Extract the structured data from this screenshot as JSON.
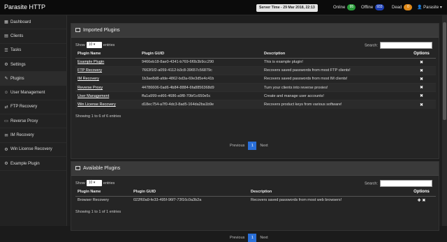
{
  "header": {
    "brand": "Parasite HTTP",
    "server_time": "Server Time - 29 Mar 2018, 22:13",
    "online_label": "Online",
    "online_count": "95",
    "offline_label": "Offline",
    "offline_count": "933",
    "dead_label": "Dead",
    "dead_count": "0",
    "user": "Parasite"
  },
  "sidebar": {
    "items": [
      {
        "label": "Dashboard",
        "icon": "dashboard-icon"
      },
      {
        "label": "Clients",
        "icon": "clients-icon"
      },
      {
        "label": "Tasks",
        "icon": "tasks-icon"
      },
      {
        "label": "Settings",
        "icon": "gear-icon"
      },
      {
        "label": "Plugins",
        "icon": "plug-icon"
      },
      {
        "label": "User Management",
        "icon": "user-icon"
      },
      {
        "label": "FTP Recovery",
        "icon": "ftp-icon"
      },
      {
        "label": "Reverse Proxy",
        "icon": "monitor-icon"
      },
      {
        "label": "IM Recovery",
        "icon": "chat-icon"
      },
      {
        "label": "Win License Recovery",
        "icon": "gears-icon"
      },
      {
        "label": "Example Plugin",
        "icon": "gear-icon"
      }
    ]
  },
  "imported": {
    "title": "Imported Plugins",
    "show_label": "Show",
    "entries_value": "10",
    "entries_label": "entries",
    "search_label": "Search:",
    "columns": [
      "Plugin Name",
      "Plugin GUID",
      "Description",
      "Options"
    ],
    "rows": [
      [
        "Example Plugin",
        "9466eb18-8ae0-4341-b769-6f0b3b9cc290",
        "This is example plugin!"
      ],
      [
        "FTP Recovery",
        "7663f1f2-a059-4112-b3c8-39657c56879c",
        "Recovers saved passwords from most FTP clients!"
      ],
      [
        "IM Recovery",
        "1b3ae8d8-afde-4862-bd3a-69e3d5e4c41b",
        "Recovers saved passwords from most IM clients!"
      ],
      [
        "Reverse Proxy",
        "44786606-0ad6-4b84-8884-6fa8856368d9",
        "Turn your clients into reverse proxies!"
      ],
      [
        "User Management",
        "ffa1a999-ed66-4686-a9f8-70bf1c650e5c",
        "Create and manage user accounts!"
      ],
      [
        "Win License Recovery",
        "d18ec754-a7f0-4dc3-8ad5-164da2ba1b9e",
        "Recovers product keys from various software!"
      ]
    ],
    "info": "Showing 1 to 6 of 6 entries",
    "prev": "Previous",
    "page": "1",
    "next": "Next"
  },
  "available": {
    "title": "Available Plugins",
    "show_label": "Show",
    "entries_value": "10",
    "entries_label": "entries",
    "search_label": "Search:",
    "columns": [
      "Plugin Name",
      "Plugin GUID",
      "Description",
      "Options"
    ],
    "rows": [
      [
        "Browser Recovery",
        "022f60a9-fe33-495f-96f7-73f16c0a3b2a",
        "Recovers saved passwords from most web browsers!"
      ]
    ],
    "info": "Showing 1 to 1 of 1 entries",
    "prev": "Previous",
    "page": "1",
    "next": "Next"
  }
}
